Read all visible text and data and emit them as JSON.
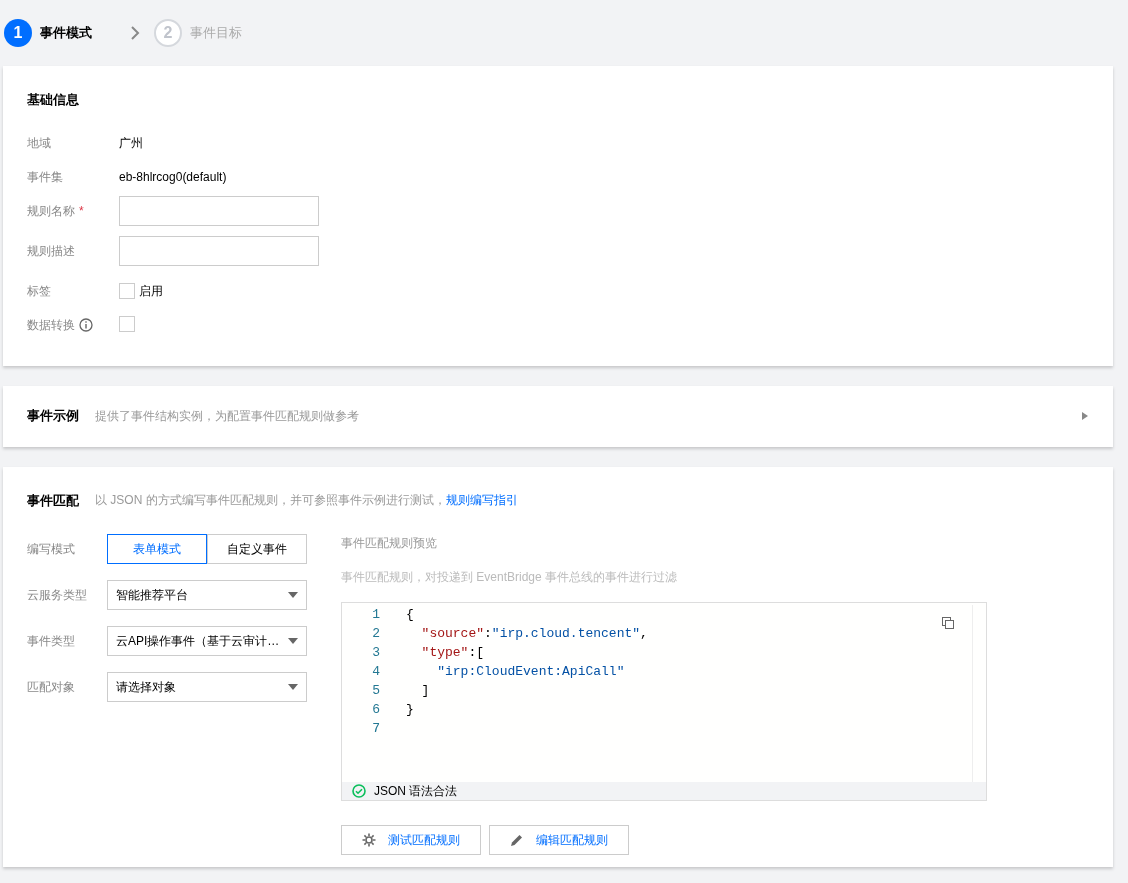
{
  "steps": [
    {
      "number": "1",
      "label": "事件模式",
      "selected": true
    },
    {
      "number": "2",
      "label": "事件目标",
      "selected": false
    }
  ],
  "basic_info": {
    "title": "基础信息",
    "fields": [
      {
        "kind": "text",
        "label": "地域",
        "value": "广州"
      },
      {
        "kind": "text",
        "label": "事件集",
        "value": "eb-8hlrcog0(default)"
      },
      {
        "kind": "input",
        "label": "规则名称",
        "required_mark": "*"
      },
      {
        "kind": "input",
        "label": "规则描述"
      },
      {
        "kind": "checkbox",
        "label": "标签",
        "option": "启用",
        "checked": false
      },
      {
        "kind": "checkbox",
        "label": "数据转换",
        "info": true,
        "checked": false
      }
    ]
  },
  "event_example": {
    "title": "事件示例",
    "description": "提供了事件结构实例，为配置事件匹配规则做参考",
    "expanded": false
  },
  "event_match": {
    "title": "事件匹配",
    "description": "以 JSON 的方式编写事件匹配规则，并可参照事件示例进行测试，",
    "link": "规则编写指引",
    "mode_label": "编写模式",
    "modes": [
      {
        "label": "表单模式",
        "selected": true
      },
      {
        "label": "自定义事件",
        "selected": false
      }
    ],
    "selects": [
      {
        "label": "云服务类型",
        "value": "智能推荐平台"
      },
      {
        "label": "事件类型",
        "value": "云API操作事件（基于云审计…"
      },
      {
        "label": "匹配对象",
        "value": "请选择对象"
      }
    ],
    "preview_title": "事件匹配规则预览",
    "preview_description": "事件匹配规则，对投递到 EventBridge 事件总线的事件进行过滤",
    "code_lines": [
      {
        "number": "1",
        "text": "{"
      },
      {
        "number": "2",
        "text": "  \"source\":\"irp.cloud.tencent\","
      },
      {
        "number": "3",
        "text": "  \"type\":["
      },
      {
        "number": "4",
        "text": "    \"irp:CloudEvent:ApiCall\""
      },
      {
        "number": "5",
        "text": "  ]"
      },
      {
        "number": "6",
        "text": "}"
      },
      {
        "number": "7"
      }
    ],
    "status": "JSON 语法合法",
    "valid": true,
    "buttons": [
      {
        "kind": "test",
        "label": "测试匹配规则"
      },
      {
        "kind": "edit",
        "label": "编辑匹配规则"
      }
    ]
  }
}
